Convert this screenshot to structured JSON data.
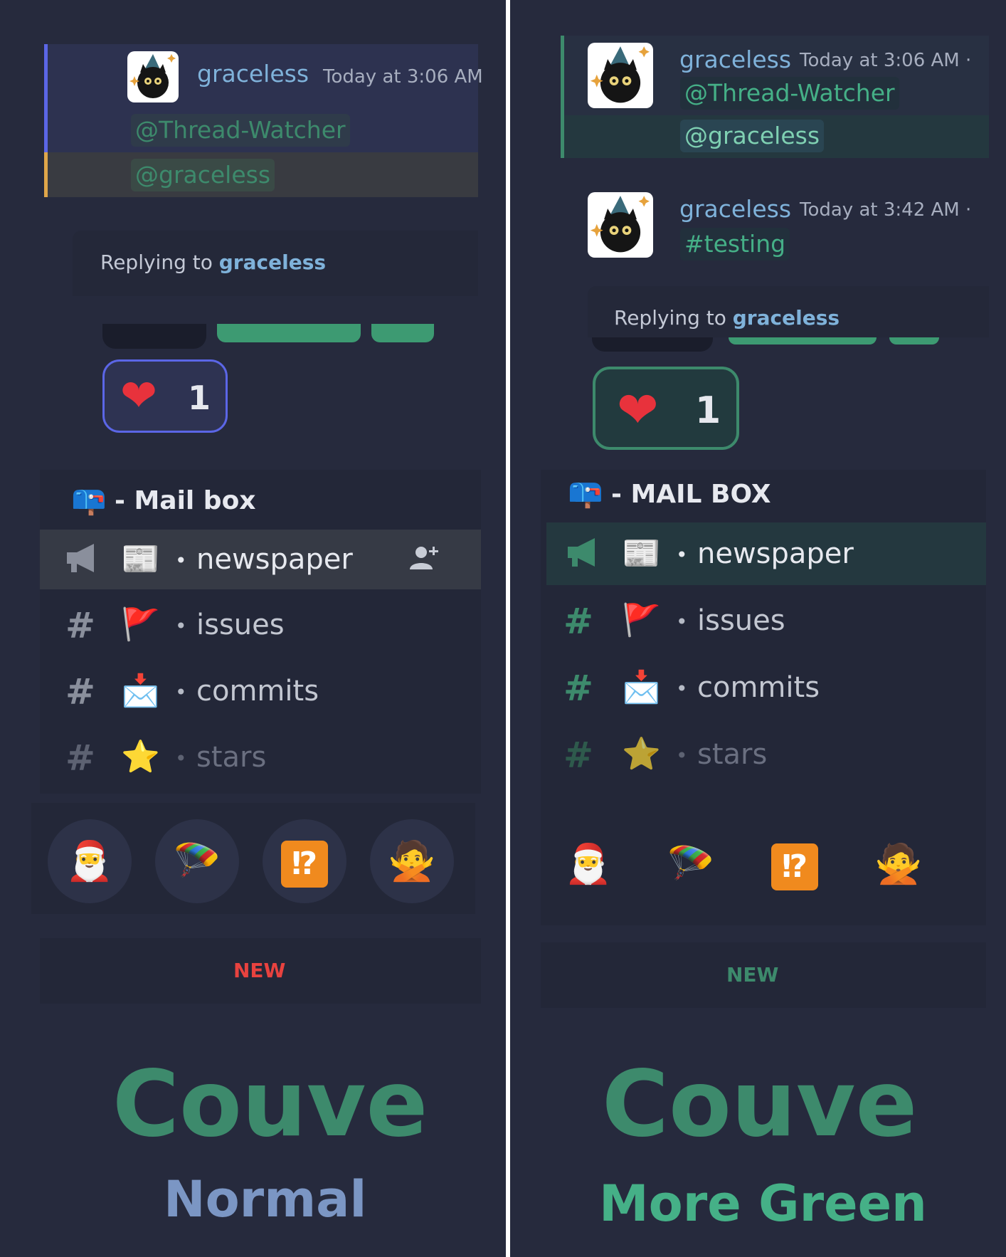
{
  "colors": {
    "page_bg": "#262a3d",
    "panel_bg": "#232738",
    "accent_green": "#3d8a6c",
    "normal_blue": "#7b96c4",
    "more_green": "#45b087",
    "new_red": "#e8423f",
    "new_green": "#3d8a6c",
    "username": "#7fb2da"
  },
  "left": {
    "message": {
      "username": "graceless",
      "timestamp": "Today at 3:06 AM",
      "mentions": [
        "@Thread-Watcher",
        "@graceless"
      ]
    },
    "reply": {
      "prefix": "Replying to ",
      "user": "graceless"
    },
    "reaction": {
      "icon": "heart-emoji",
      "count": "1"
    },
    "category": {
      "icon": "mailbox-emoji",
      "title": "- Mail box"
    },
    "channels": [
      {
        "type_icon": "megaphone-icon",
        "emoji": "📰",
        "name": "newspaper",
        "selected": true
      },
      {
        "type_icon": "hash-icon",
        "emoji": "🚩",
        "name": "issues"
      },
      {
        "type_icon": "hash-icon",
        "emoji": "📩",
        "name": "commits"
      },
      {
        "type_icon": "hash-icon",
        "emoji": "⭐",
        "name": "stars",
        "muted": true
      }
    ],
    "emoji_bar": [
      "santa-hat-skull",
      "skydiver",
      "interrobang",
      "no-gesture-person"
    ],
    "new_label": "NEW",
    "brand": "Couve",
    "variant": "Normal"
  },
  "right": {
    "messages": [
      {
        "username": "graceless",
        "timestamp": "Today at 3:06 AM ·",
        "mentions": [
          "@Thread-Watcher",
          "@graceless"
        ]
      },
      {
        "username": "graceless",
        "timestamp": "Today at 3:42 AM ·",
        "channel_mention": "#testing"
      }
    ],
    "reply": {
      "prefix": "Replying to ",
      "user": "graceless"
    },
    "reaction": {
      "icon": "heart-emoji",
      "count": "1"
    },
    "category": {
      "icon": "mailbox-emoji",
      "title": "- MAIL BOX"
    },
    "channels": [
      {
        "type_icon": "megaphone-icon",
        "emoji": "📰",
        "name": "newspaper",
        "selected": true
      },
      {
        "type_icon": "hash-icon",
        "emoji": "🚩",
        "name": "issues"
      },
      {
        "type_icon": "hash-icon",
        "emoji": "📩",
        "name": "commits"
      },
      {
        "type_icon": "hash-icon",
        "emoji": "⭐",
        "name": "stars",
        "muted": true
      }
    ],
    "emoji_bar": [
      "santa-hat-skull",
      "skydiver",
      "interrobang",
      "no-gesture-person"
    ],
    "new_label": "NEW",
    "brand": "Couve",
    "variant": "More Green"
  },
  "glyphs": {
    "heart": "❤",
    "mailbox": "📪",
    "hash": "#",
    "dot": "•",
    "santa": "🎅",
    "skydiver": "🪂",
    "interrobang": "⁉",
    "no_gesture": "🙅",
    "add_member": "👤+"
  }
}
